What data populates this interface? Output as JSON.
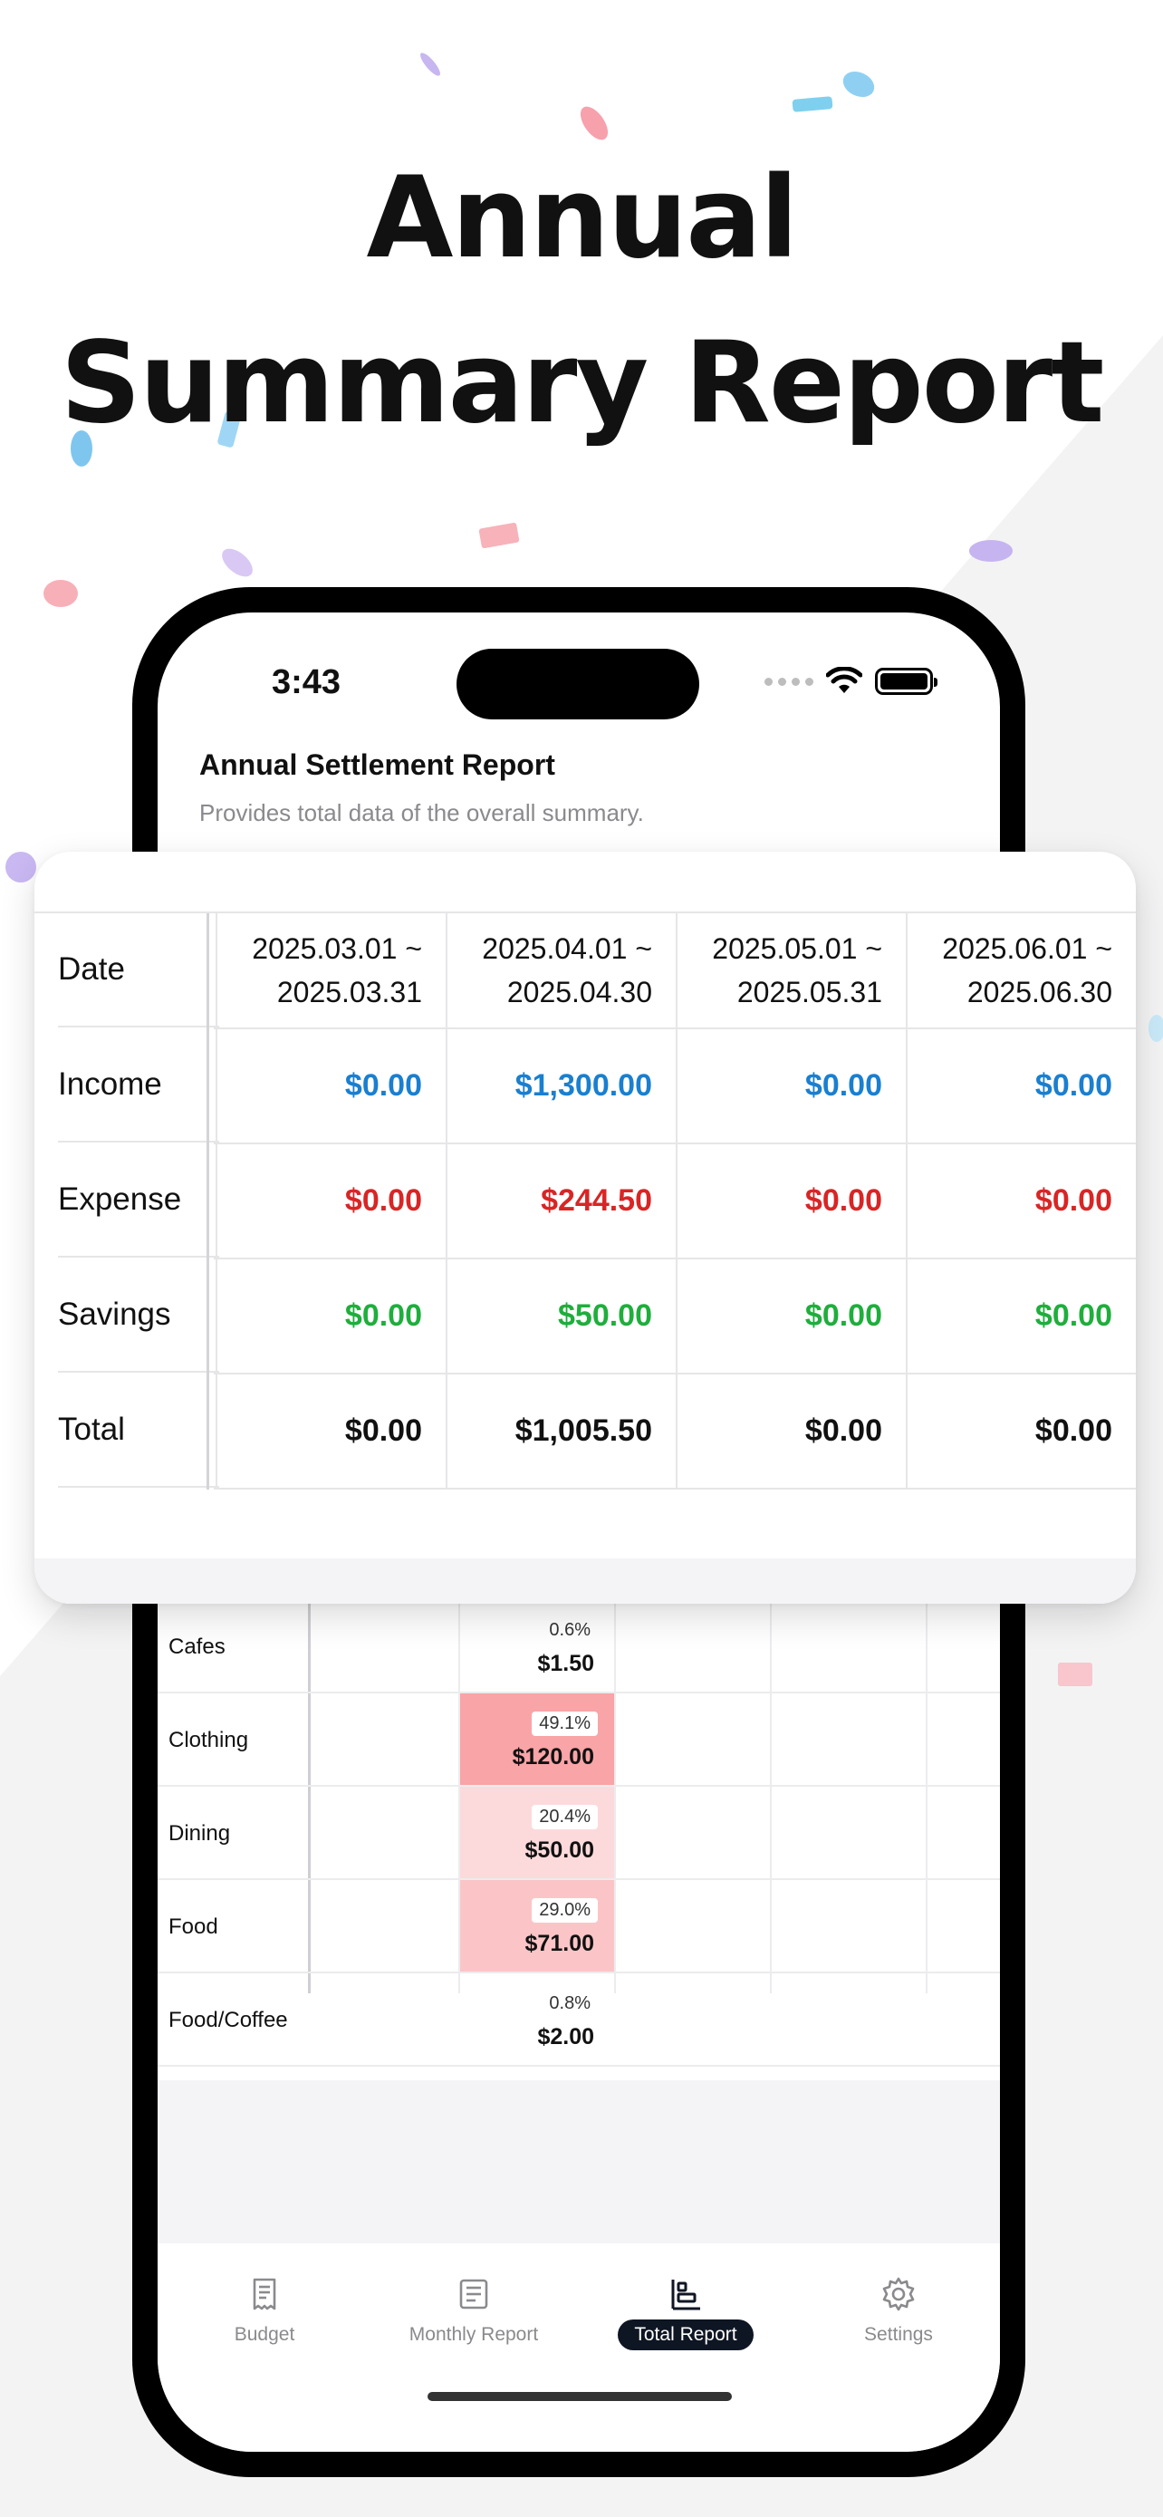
{
  "headline": {
    "line1": "Annual",
    "line2": "Summary Report"
  },
  "status_bar": {
    "time": "3:43"
  },
  "screen": {
    "title": "Annual Settlement Report",
    "subtitle": "Provides total data of the overall summary."
  },
  "summary_table": {
    "row_labels": {
      "date": "Date",
      "income": "Income",
      "expense": "Expense",
      "savings": "Savings",
      "total": "Total"
    },
    "columns": [
      {
        "start": "2025.03.01 ~",
        "end": "2025.03.31",
        "income": "$0.00",
        "expense": "$0.00",
        "savings": "$0.00",
        "total": "$0.00"
      },
      {
        "start": "2025.04.01 ~",
        "end": "2025.04.30",
        "income": "$1,300.00",
        "expense": "$244.50",
        "savings": "$50.00",
        "total": "$1,005.50"
      },
      {
        "start": "2025.05.01 ~",
        "end": "2025.05.31",
        "income": "$0.00",
        "expense": "$0.00",
        "savings": "$0.00",
        "total": "$0.00"
      },
      {
        "start": "2025.06.01 ~",
        "end": "2025.06.30",
        "income": "$0.00",
        "expense": "$0.00",
        "savings": "$0.00",
        "total": "$0.00"
      }
    ],
    "colors": {
      "income": "#1a7fd0",
      "expense": "#d92525",
      "savings": "#1fae3c",
      "total": "#111111"
    }
  },
  "category_table": {
    "rows": [
      {
        "name": "Cafes",
        "pct": "0.6%",
        "amount": "$1.50",
        "fill": "#ffffff"
      },
      {
        "name": "Clothing",
        "pct": "49.1%",
        "amount": "$120.00",
        "fill": "#f9a4a7"
      },
      {
        "name": "Dining",
        "pct": "20.4%",
        "amount": "$50.00",
        "fill": "#fcdadb"
      },
      {
        "name": "Food",
        "pct": "29.0%",
        "amount": "$71.00",
        "fill": "#fbc5c7"
      },
      {
        "name": "Food/Coffee",
        "pct": "0.8%",
        "amount": "$2.00",
        "fill": "#ffffff"
      }
    ]
  },
  "tabbar": {
    "tabs": [
      {
        "label": "Budget",
        "icon": "receipt-icon"
      },
      {
        "label": "Monthly Report",
        "icon": "document-icon"
      },
      {
        "label": "Total Report",
        "icon": "report-chart-icon",
        "active": true
      },
      {
        "label": "Settings",
        "icon": "gear-icon"
      }
    ]
  }
}
